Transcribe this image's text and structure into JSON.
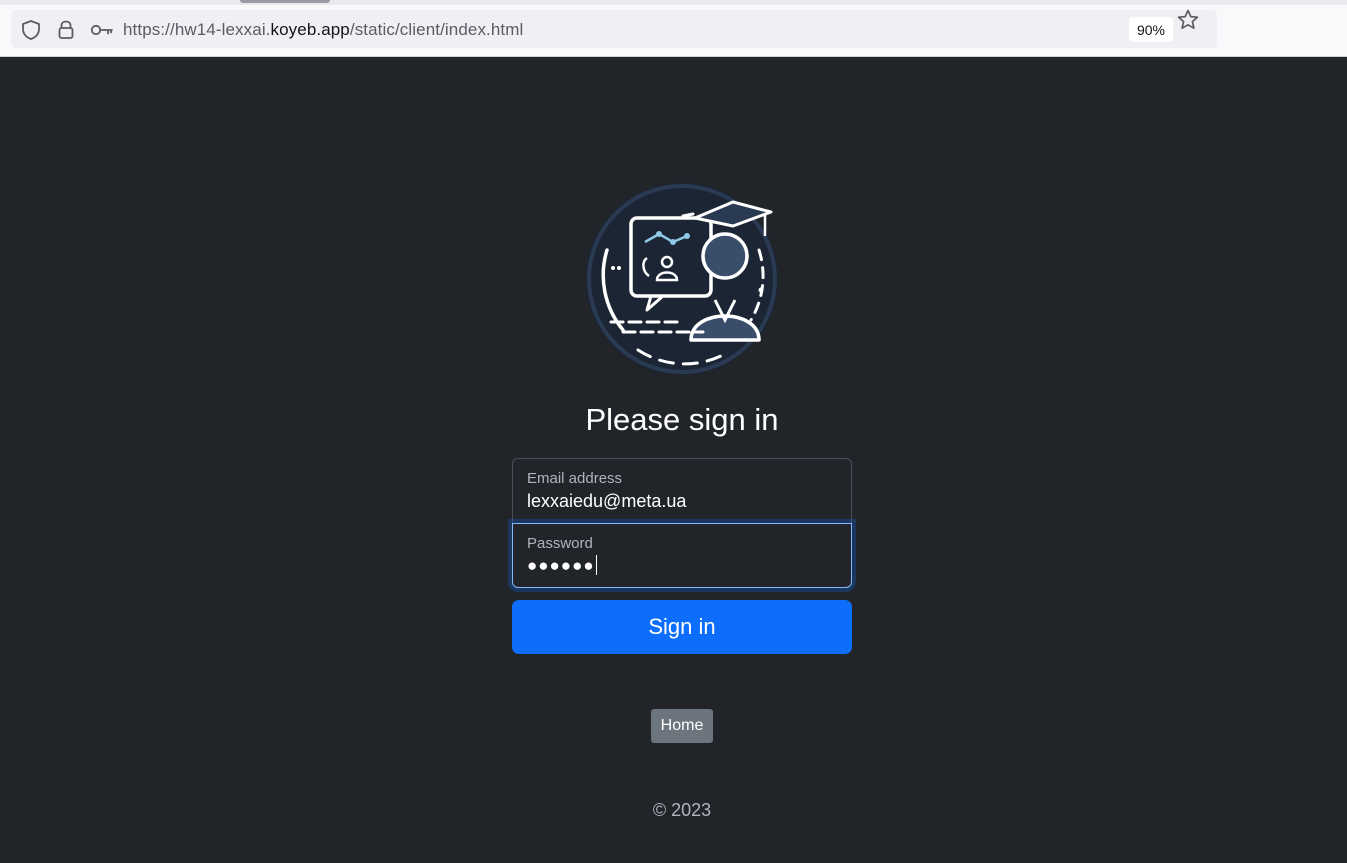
{
  "browser": {
    "url_prefix": "https://hw14-lexxai.",
    "url_domain": "koyeb.app",
    "url_path": "/static/client/index.html",
    "zoom_level": "90%",
    "icons": [
      "shield-icon",
      "lock-icon",
      "key-icon",
      "star-icon"
    ]
  },
  "page": {
    "logo_icon": "graduate-presentation-logo",
    "heading": "Please sign in",
    "email_label": "Email address",
    "email_value": "lexxaiedu@meta.ua",
    "password_label": "Password",
    "password_value": "●●●●●●",
    "signin_label": "Sign in",
    "home_label": "Home",
    "footer": "© 2023"
  },
  "colors": {
    "background": "#212529",
    "primary": "#0d6efd",
    "secondary": "#6c757d",
    "focus_border": "#86b7fe"
  }
}
